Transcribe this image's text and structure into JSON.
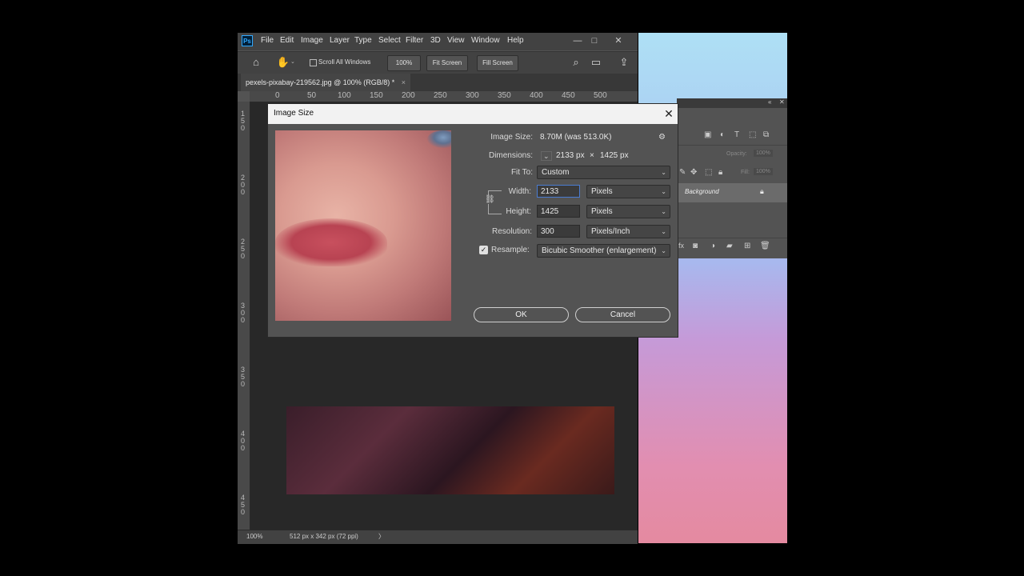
{
  "app": {
    "logo": "Ps",
    "menu": [
      "File",
      "Edit",
      "Image",
      "Layer",
      "Type",
      "Select",
      "Filter",
      "3D",
      "View",
      "Window",
      "Help"
    ],
    "window_controls": {
      "minimize": "—",
      "restore": "□",
      "close": "✕"
    }
  },
  "options": {
    "scroll_all_windows": "Scroll All Windows",
    "zoom": "100%",
    "fit_screen": "Fit Screen",
    "fill_screen": "Fill Screen"
  },
  "document": {
    "tab_title": "pexels-pixabay-219562.jpg @ 100% (RGB/8) *",
    "tab_close": "×",
    "ruler_top_ticks": [
      "0",
      "50",
      "100",
      "150",
      "200",
      "250",
      "300",
      "350",
      "400",
      "450",
      "500"
    ],
    "status_zoom": "100%",
    "status_info": "512 px x 342 px (72 ppi)",
    "status_arrow": "〉"
  },
  "layers": {
    "background_label": "Background",
    "opacity_label": "Opacity:",
    "opacity_value": "100%",
    "fill_label": "Fill:",
    "fill_value": "100%"
  },
  "dialog": {
    "title": "Image Size",
    "close": "✕",
    "image_size_label": "Image Size:",
    "image_size_value": "8.70M (was 513.0K)",
    "dimensions_label": "Dimensions:",
    "dimensions_w": "2133 px",
    "dimensions_x": "×",
    "dimensions_h": "1425 px",
    "fit_to_label": "Fit To:",
    "fit_to_value": "Custom",
    "width_label": "Width:",
    "width_value": "2133",
    "width_unit": "Pixels",
    "height_label": "Height:",
    "height_value": "1425",
    "height_unit": "Pixels",
    "resolution_label": "Resolution:",
    "resolution_value": "300",
    "resolution_unit": "Pixels/Inch",
    "resample_label": "Resample:",
    "resample_checked": true,
    "resample_value": "Bicubic Smoother (enlargement)",
    "ok_label": "OK",
    "cancel_label": "Cancel"
  }
}
